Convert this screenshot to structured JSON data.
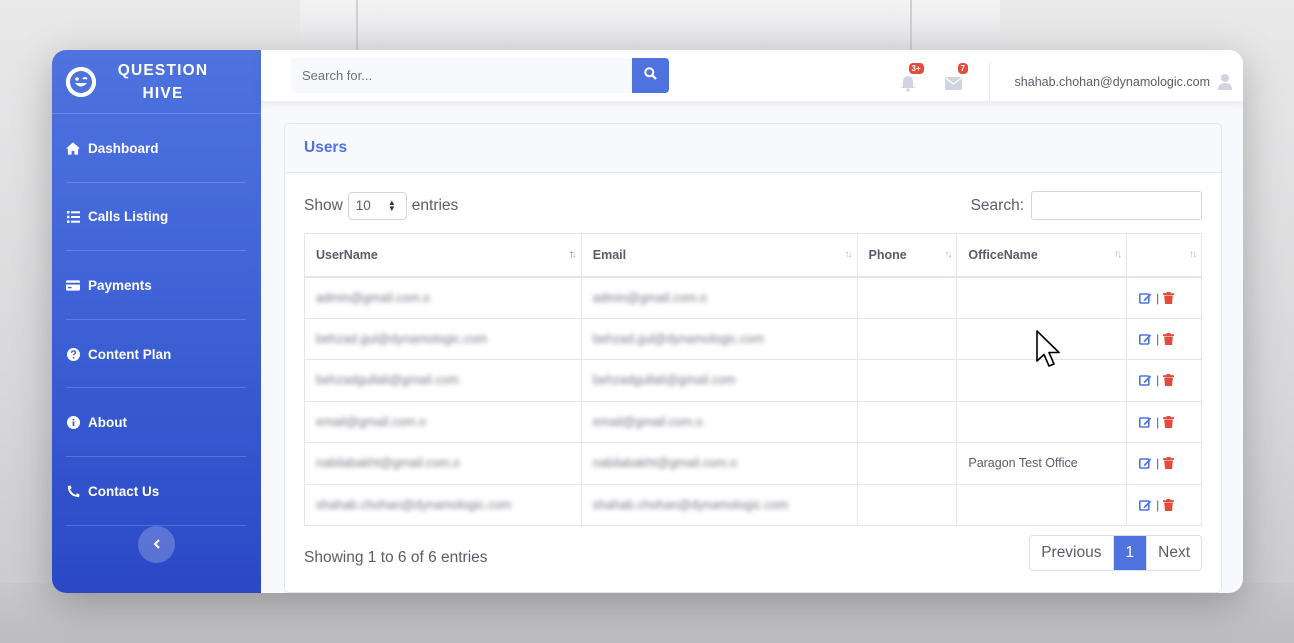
{
  "brand": {
    "line1": "QUESTION",
    "line2": "HIVE"
  },
  "sidebar": {
    "items": [
      {
        "label": "Dashboard",
        "icon": "home-icon"
      },
      {
        "label": "Calls Listing",
        "icon": "list-icon"
      },
      {
        "label": "Payments",
        "icon": "credit-card-icon"
      },
      {
        "label": "Content Plan",
        "icon": "question-circle-icon"
      },
      {
        "label": "About",
        "icon": "info-circle-icon"
      },
      {
        "label": "Contact Us",
        "icon": "phone-icon"
      }
    ]
  },
  "topbar": {
    "search_placeholder": "Search for...",
    "alerts_badge": "3+",
    "messages_badge": "7",
    "user_email": "shahab.chohan@dynamologic.com"
  },
  "card": {
    "title": "Users"
  },
  "controls": {
    "show_label": "Show",
    "entries_value": "10",
    "entries_label": "entries",
    "search_label": "Search:"
  },
  "table": {
    "headers": [
      "UserName",
      "Email",
      "Phone",
      "OfficeName",
      ""
    ],
    "rows": [
      {
        "username": "admin@gmail.com.o",
        "email": "admin@gmail.com.o",
        "phone": "",
        "office": ""
      },
      {
        "username": "behzad.gul@dynamologic.com",
        "email": "behzad.gul@dynamologic.com",
        "phone": "",
        "office": ""
      },
      {
        "username": "behzadgullali@gmail.com",
        "email": "behzadgullali@gmail.com",
        "phone": "",
        "office": ""
      },
      {
        "username": "email@gmail.com.o",
        "email": "email@gmail.com.o",
        "phone": "",
        "office": ""
      },
      {
        "username": "nabilabakht@gmail.com.o",
        "email": "nabilabakht@gmail.com.o",
        "phone": "",
        "office": "Paragon Test Office"
      },
      {
        "username": "shahab.chohan@dynamologic.com",
        "email": "shahab.chohan@dynamologic.com",
        "phone": "",
        "office": ""
      }
    ],
    "action_separator": "|"
  },
  "footer": {
    "info": "Showing 1 to 6 of 6 entries",
    "prev": "Previous",
    "page": "1",
    "next": "Next"
  },
  "colors": {
    "primary": "#4e73df",
    "danger": "#e74a3b",
    "text": "#5a5c69"
  }
}
